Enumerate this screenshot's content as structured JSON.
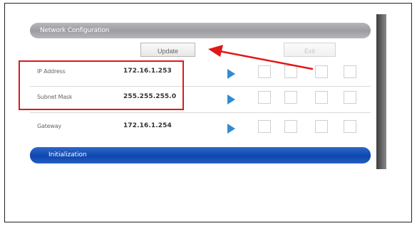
{
  "window": {
    "header_title": "Network Configuration",
    "section_initialization": "Initialization"
  },
  "buttons": {
    "update_label": "Update",
    "exit_label": "Exit"
  },
  "rows": [
    {
      "label": "IP Address",
      "value": "172.16.1.253"
    },
    {
      "label": "Subnet Mask",
      "value": "255.255.255.0"
    },
    {
      "label": "Gateway",
      "value": "172.16.1.254"
    }
  ],
  "colors": {
    "highlight_border": "#e01818",
    "arrow": "#e01818",
    "accent_blue": "#2f8bd4",
    "initialization_bar": "#0d46b0"
  },
  "icons": {
    "apply": "play-icon"
  }
}
